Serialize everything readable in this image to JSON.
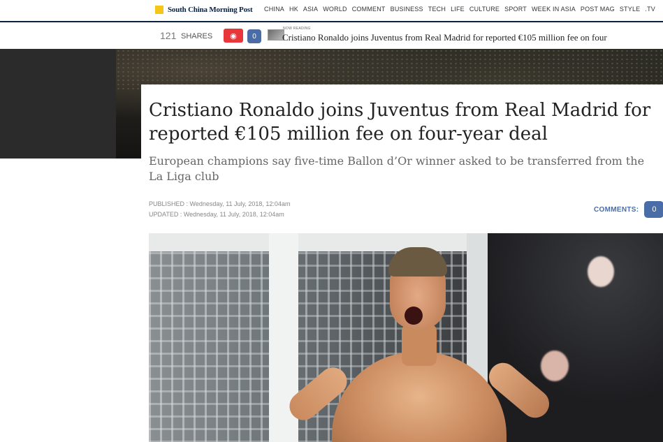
{
  "topnav": {
    "brand": "South China Morning Post",
    "brand_icon": "scmp-logo-square",
    "links": [
      "CHINA",
      "HK",
      "ASIA",
      "WORLD",
      "COMMENT",
      "BUSINESS",
      "TECH",
      "LIFE",
      "CULTURE",
      "SPORT",
      "WEEK IN ASIA",
      "POST MAG",
      "STYLE",
      ".TV"
    ]
  },
  "sharebar": {
    "shares_count": "121",
    "shares_label": "SHARES",
    "weibo_icon": "weibo-icon",
    "comment_count": "0",
    "now_reading_label": "NOW READING",
    "now_reading_title": "Cristiano Ronaldo joins Juventus from Real Madrid for reported €105 million fee on four"
  },
  "article": {
    "headline": "Cristiano Ronaldo joins Juventus from Real Madrid for reported €105 million fee on four-year deal",
    "subheadline": "European champions say five-time Ballon d’Or winner asked to be transferred from the La Liga club",
    "published": "PUBLISHED : Wednesday, 11 July, 2018, 12:04am",
    "updated": "UPDATED : Wednesday, 11 July, 2018, 12:04am",
    "comments_label": "COMMENTS:",
    "comments_count": "0"
  },
  "colors": {
    "brand_navy": "#0a2240",
    "brand_yellow": "#f5c518",
    "comments_blue": "#4a6da7",
    "weibo_red": "#e8373a"
  }
}
